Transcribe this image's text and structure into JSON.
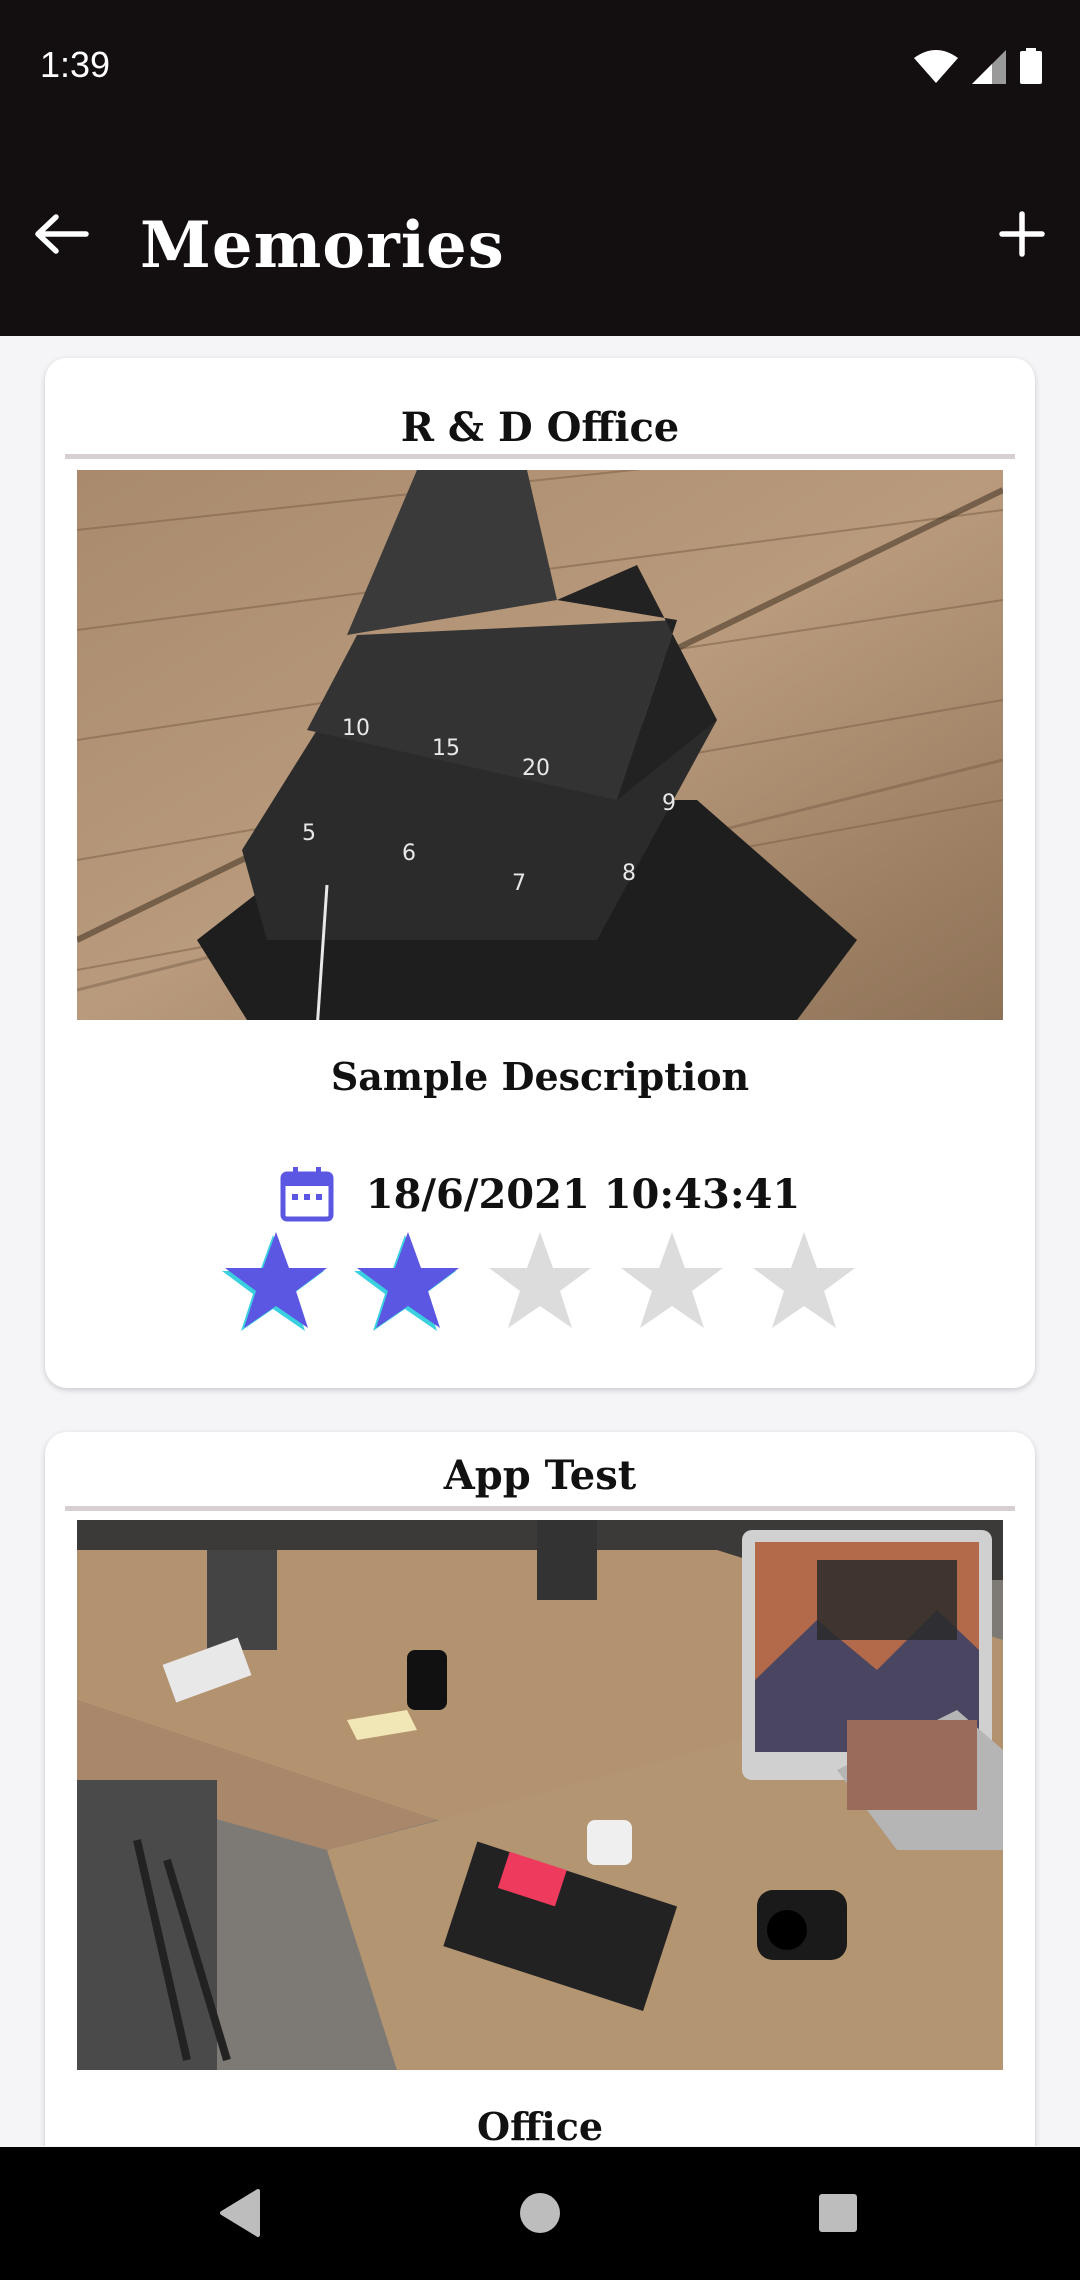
{
  "status_bar": {
    "time": "1:39"
  },
  "app_bar": {
    "title": "Memories",
    "back_icon": "arrow-left-icon",
    "add_icon": "plus-icon"
  },
  "cards": [
    {
      "title": "R & D Office",
      "photo": "pyramid-timer-on-wooden-table",
      "description": "Sample Description",
      "date": "18/6/2021 10:43:41",
      "rating": 2,
      "rating_max": 5
    },
    {
      "title": "App Test",
      "photo": "office-desks-with-computers",
      "description": "Office"
    }
  ],
  "colors": {
    "accent": "#5b57e2",
    "bar_bg": "#130f10",
    "star_empty": "#dcdcdc"
  }
}
